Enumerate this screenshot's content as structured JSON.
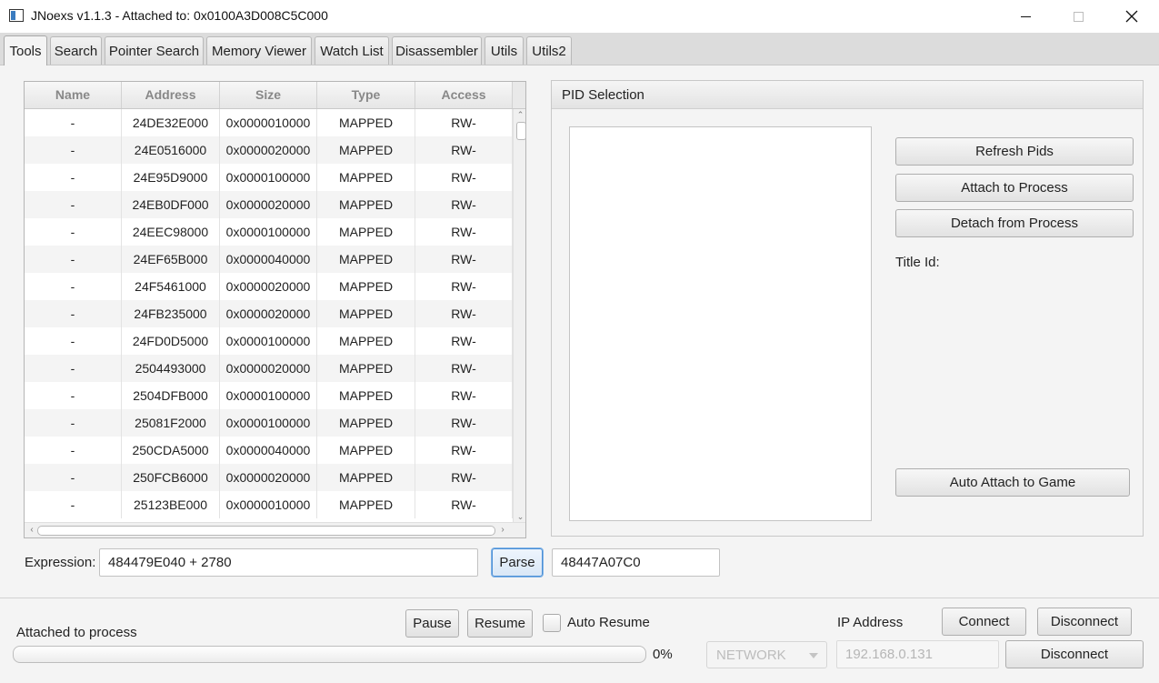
{
  "window": {
    "title": "JNoexs v1.1.3 - Attached to: 0x0100A3D008C5C000",
    "controls": {
      "minimize": "minimize-icon",
      "maximize": "maximize-icon",
      "close": "close-icon"
    }
  },
  "tabs": [
    {
      "label": "Tools",
      "active": true
    },
    {
      "label": "Search"
    },
    {
      "label": "Pointer Search"
    },
    {
      "label": "Memory Viewer"
    },
    {
      "label": "Watch List"
    },
    {
      "label": "Disassembler"
    },
    {
      "label": "Utils"
    },
    {
      "label": "Utils2"
    }
  ],
  "memory_table": {
    "columns": [
      "Name",
      "Address",
      "Size",
      "Type",
      "Access"
    ],
    "rows": [
      [
        "-",
        "24DE32E000",
        "0x0000010000",
        "MAPPED",
        "RW-"
      ],
      [
        "-",
        "24E0516000",
        "0x0000020000",
        "MAPPED",
        "RW-"
      ],
      [
        "-",
        "24E95D9000",
        "0x0000100000",
        "MAPPED",
        "RW-"
      ],
      [
        "-",
        "24EB0DF000",
        "0x0000020000",
        "MAPPED",
        "RW-"
      ],
      [
        "-",
        "24EEC98000",
        "0x0000100000",
        "MAPPED",
        "RW-"
      ],
      [
        "-",
        "24EF65B000",
        "0x0000040000",
        "MAPPED",
        "RW-"
      ],
      [
        "-",
        "24F5461000",
        "0x0000020000",
        "MAPPED",
        "RW-"
      ],
      [
        "-",
        "24FB235000",
        "0x0000020000",
        "MAPPED",
        "RW-"
      ],
      [
        "-",
        "24FD0D5000",
        "0x0000100000",
        "MAPPED",
        "RW-"
      ],
      [
        "-",
        "2504493000",
        "0x0000020000",
        "MAPPED",
        "RW-"
      ],
      [
        "-",
        "2504DFB000",
        "0x0000100000",
        "MAPPED",
        "RW-"
      ],
      [
        "-",
        "25081F2000",
        "0x0000100000",
        "MAPPED",
        "RW-"
      ],
      [
        "-",
        "250CDA5000",
        "0x0000040000",
        "MAPPED",
        "RW-"
      ],
      [
        "-",
        "250FCB6000",
        "0x0000020000",
        "MAPPED",
        "RW-"
      ],
      [
        "-",
        "25123BE000",
        "0x0000010000",
        "MAPPED",
        "RW-"
      ]
    ]
  },
  "pid_panel": {
    "title": "PID Selection",
    "refresh_label": "Refresh Pids",
    "attach_label": "Attach to Process",
    "detach_label": "Detach from Process",
    "title_id_label": "Title Id:",
    "auto_attach_label": "Auto Attach to Game"
  },
  "expression": {
    "label": "Expression:",
    "value": "484479E040 + 2780",
    "parse_label": "Parse",
    "result": "48447A07C0"
  },
  "status_bar": {
    "status_text": "Attached to process",
    "progress_percent": "0%",
    "progress_value": 0,
    "pause_label": "Pause",
    "resume_label": "Resume",
    "auto_resume_label": "Auto Resume",
    "auto_resume_checked": false,
    "connection_type": "NETWORK",
    "ip_label": "IP Address",
    "ip_value": "192.168.0.131",
    "connect_label": "Connect",
    "disconnect_label": "Disconnect",
    "disconnect2_label": "Disconnect"
  }
}
